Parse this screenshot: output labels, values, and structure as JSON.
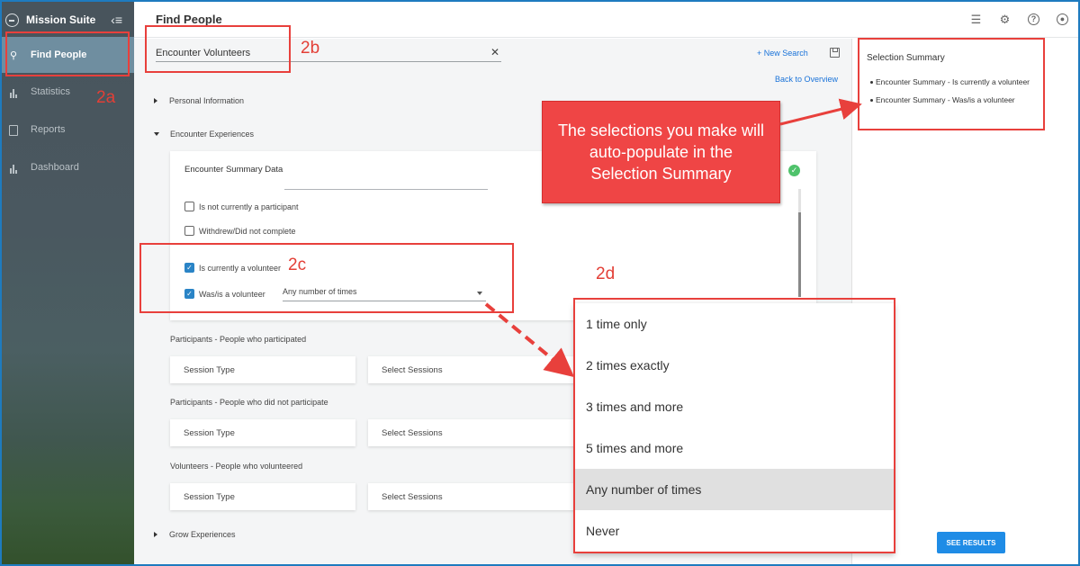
{
  "sidebar": {
    "brand": "Mission Suite",
    "collapse_icon": "menu-collapse-icon",
    "items": [
      {
        "label": "Find People",
        "icon": "find-people-icon",
        "active": true
      },
      {
        "label": "Statistics",
        "icon": "bar-chart-icon"
      },
      {
        "label": "Reports",
        "icon": "document-icon"
      },
      {
        "label": "Dashboard",
        "icon": "bar-chart-icon"
      }
    ]
  },
  "header": {
    "title": "Find People",
    "icons": [
      "chat-icon",
      "gear-icon",
      "help-icon",
      "account-icon"
    ]
  },
  "search": {
    "value": "Encounter Volunteers",
    "new_search": "+ New Search",
    "back": "Back to Overview"
  },
  "sections": {
    "personal": "Personal Information",
    "encounter": "Encounter Experiences",
    "grow": "Grow Experiences"
  },
  "card": {
    "title": "Encounter Summary Data",
    "checkboxes": [
      {
        "label": "Is not currently a participant",
        "checked": false
      },
      {
        "label": "Withdrew/Did not complete",
        "checked": false
      },
      {
        "label": "Is currently a volunteer",
        "checked": true
      },
      {
        "label": "Was/is a volunteer",
        "checked": true
      }
    ],
    "select_value": "Any number of times"
  },
  "groups": [
    {
      "label": "Participants - People who participated",
      "session_type": "Session Type",
      "select_sessions": "Select Sessions"
    },
    {
      "label": "Participants - People who did not participate",
      "session_type": "Session Type",
      "select_sessions": "Select Sessions"
    },
    {
      "label": "Volunteers - People who volunteered",
      "session_type": "Session Type",
      "select_sessions": "Select Sessions"
    }
  ],
  "dropdown": {
    "options": [
      "1 time only",
      "2 times exactly",
      "3 times and more",
      "5 times and more",
      "Any number of times",
      "Never"
    ],
    "highlighted": "Any number of times"
  },
  "summary": {
    "title": "Selection Summary",
    "items": [
      "Encounter Summary - Is currently a volunteer",
      "Encounter Summary - Was/is a volunteer"
    ]
  },
  "see_results": "SEE RESULTS",
  "annotations": {
    "a": "2a",
    "b": "2b",
    "c": "2c",
    "d": "2d",
    "callout": "The selections you make will auto-populate in the Selection Summary",
    "accent": "#e8403c"
  }
}
